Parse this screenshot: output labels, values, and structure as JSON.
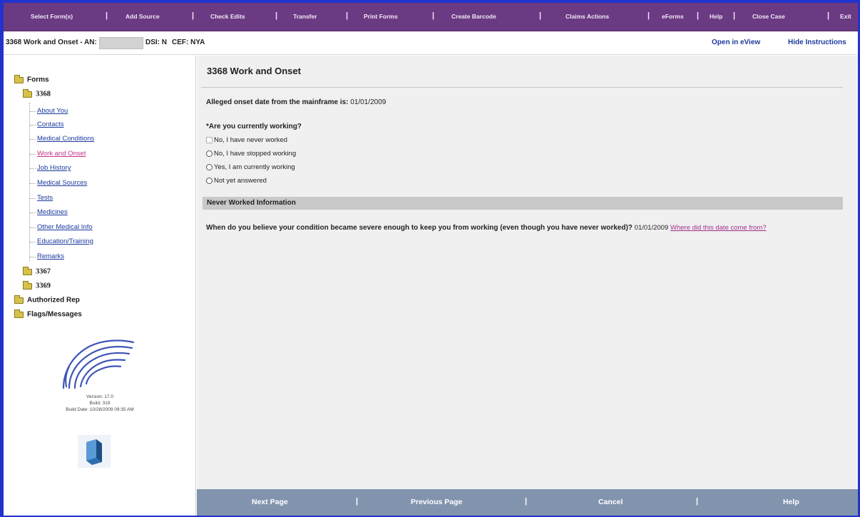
{
  "menu": {
    "items": [
      "Select Form(s)",
      "Add Source",
      "Check Edits",
      "Transfer",
      "Print Forms",
      "Create Barcode",
      "Claims Actions",
      "eForms",
      "Help",
      "Close Case",
      "Exit"
    ]
  },
  "titlebar": {
    "case_label": "3368 Work and Onset - AN:",
    "dsi": "DSI: N",
    "cef": "CEF: NYA",
    "open_eview": "Open in eView",
    "hide_instructions": "Hide Instructions"
  },
  "tree": {
    "root": "Forms",
    "form_3368": "3368",
    "children": [
      "About You",
      "Contacts",
      "Medical Conditions",
      "Work and Onset",
      "Job History",
      "Medical Sources",
      "Tests",
      "Medicines",
      "Other Medical Info",
      "Education/Training",
      "Remarks"
    ],
    "form_3367": "3367",
    "form_3369": "3369",
    "authorized_rep": "Authorized Rep",
    "flags_messages": "Flags/Messages"
  },
  "version_info": {
    "version": "Version: 17.0",
    "build": "Build: 319",
    "build_date": "Build Date: 10/28/2009 09:35 AM"
  },
  "main": {
    "heading": "3368 Work and Onset",
    "onset_label": "Alleged onset date from the mainframe is:",
    "onset_value": "01/01/2009",
    "question": "*Are you currently working?",
    "options": [
      "No, I have never worked",
      "No, I have stopped working",
      "Yes, I am currently working",
      "Not yet answered"
    ],
    "section_title": "Never Worked Information",
    "severe_question": "When do you believe your condition became severe enough to keep you from working (even though you have never worked)?",
    "severe_value": "01/01/2009",
    "severe_link": "Where did this date come from?"
  },
  "bottom": {
    "next": "Next Page",
    "previous": "Previous Page",
    "cancel": "Cancel",
    "help": "Help"
  },
  "colors": {
    "menu_bg": "#6a3a82",
    "bottom_bg": "#8294ad",
    "link": "#1c3a9e",
    "active_link": "#c2328a",
    "frame_border": "#2233cc"
  }
}
